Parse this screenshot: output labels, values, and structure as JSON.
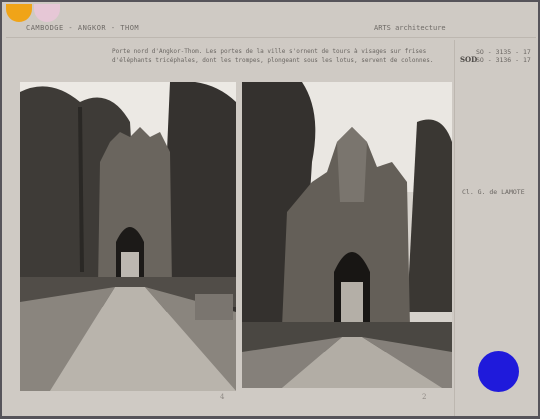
{
  "header": {
    "title": "CAMBODGE - ANGKOR - THOM",
    "category": "ARTS  architecture"
  },
  "caption": "Porte nord d'Angkor-Thom. Les portes de la ville s'ornent de tours à visages sur frises d'éléphants tricéphales, dont les trompes, plongeant sous les lotus, servent de colonnes.",
  "reference": {
    "mark": "SOD",
    "lines": [
      "SO - 3135 - 17",
      "SO - 3136 - 17"
    ]
  },
  "credit": "Cl. G. de LAMOTE",
  "photos": [
    {
      "label": "photo-left",
      "number": "4"
    },
    {
      "label": "photo-right",
      "number": "2"
    }
  ],
  "colors": {
    "stamp_blue": "#1f1adb",
    "tab_orange": "#f0a418",
    "tab_pink": "#e6c7d6"
  }
}
